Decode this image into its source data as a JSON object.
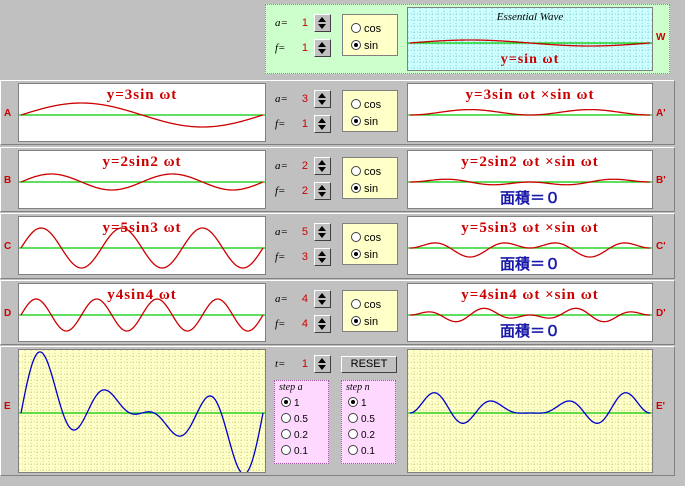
{
  "top": {
    "a_label": "a=",
    "a_value": "1",
    "f_label": "f=",
    "f_value": "1",
    "options": [
      "cos",
      "sin"
    ],
    "selected": "sin",
    "essential_title": "Essential Wave",
    "essential_eq": "y=sin ωt",
    "side_mark": "W"
  },
  "rows": [
    {
      "id": "A",
      "id2": "A'",
      "a": "3",
      "f": "1",
      "selected": "sin",
      "left_eq": "y=3sin ωt",
      "right_eq": "y=3sin ωt ×sin ωt",
      "area": ""
    },
    {
      "id": "B",
      "id2": "B'",
      "a": "2",
      "f": "2",
      "selected": "sin",
      "left_eq": "y=2sin2 ωt",
      "right_eq": "y=2sin2 ωt ×sin ωt",
      "area": "面積＝０"
    },
    {
      "id": "C",
      "id2": "C'",
      "a": "5",
      "f": "3",
      "selected": "sin",
      "left_eq": "y=5sin3 ωt",
      "right_eq": "y=5sin3 ωt ×sin ωt",
      "area": "面積＝０"
    },
    {
      "id": "D",
      "id2": "D'",
      "a": "4",
      "f": "4",
      "selected": "sin",
      "left_eq": "y4sin4 ωt",
      "right_eq": "y=4sin4 ωt ×sin ωt",
      "area": "面積＝０"
    }
  ],
  "row_e": {
    "id": "E",
    "id2": "E'",
    "t_label": "t=",
    "t_value": "1",
    "reset_label": "RESET",
    "step_a": {
      "title": "step a",
      "options": [
        "1",
        "0.5",
        "0.2",
        "0.1"
      ],
      "selected": "1"
    },
    "step_n": {
      "title": "step n",
      "options": [
        "1",
        "0.5",
        "0.2",
        "0.1"
      ],
      "selected": "1"
    }
  },
  "colors": {
    "wave": "#cc0000",
    "axis": "#00cc00",
    "sum_wave": "#0000cc",
    "area_text": "#1a1aaa"
  }
}
